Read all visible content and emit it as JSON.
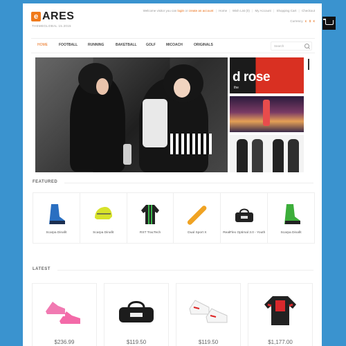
{
  "brand": {
    "logo_letter": "e",
    "name": "ARES",
    "tagline": "THEMEGLOBAL 15.2015"
  },
  "toplinks": {
    "welcome": "Welcome visitor you can",
    "login": "login",
    "or": "or",
    "create": "create an account",
    "items": [
      "Home",
      "Wish List (0)",
      "My Account",
      "Shopping Cart",
      "Checkout"
    ]
  },
  "currency": {
    "label": "Currency",
    "options": [
      "£",
      "$",
      "€"
    ]
  },
  "nav": {
    "items": [
      "HOME",
      "FOOTBALL",
      "RUNNING",
      "BAKETBALL",
      "GOLF",
      "MICOACH",
      "ORIGINALS"
    ],
    "search_placeholder": "Search"
  },
  "banner": {
    "thumb1_title": "d rose",
    "thumb1_sub": "the"
  },
  "featured": {
    "title": "FEATURED",
    "items": [
      {
        "name": "Scarpa Dinafit",
        "icon": "blue-ski-boot"
      },
      {
        "name": "Scarpa Dinafit",
        "icon": "yellow-helmet"
      },
      {
        "name": "RST TracTech",
        "icon": "green-jacket"
      },
      {
        "name": "Dual Sport X",
        "icon": "snowboard"
      },
      {
        "name": "RealFlex Optimal 3.0 - Youth",
        "icon": "sport-bag"
      },
      {
        "name": "Scarpa Dinafit",
        "icon": "green-ski-boot"
      }
    ]
  },
  "latest": {
    "title": "LATEST",
    "items": [
      {
        "price": "$236.99",
        "icon": "pink-sneakers"
      },
      {
        "price": "$119.50",
        "icon": "reebok-bag"
      },
      {
        "price": "$119.50",
        "icon": "white-red-sneakers"
      },
      {
        "price": "$1,177.00",
        "icon": "red-moto-jacket"
      }
    ]
  },
  "colors": {
    "accent": "#e96d14",
    "background": "#3a93cf"
  }
}
